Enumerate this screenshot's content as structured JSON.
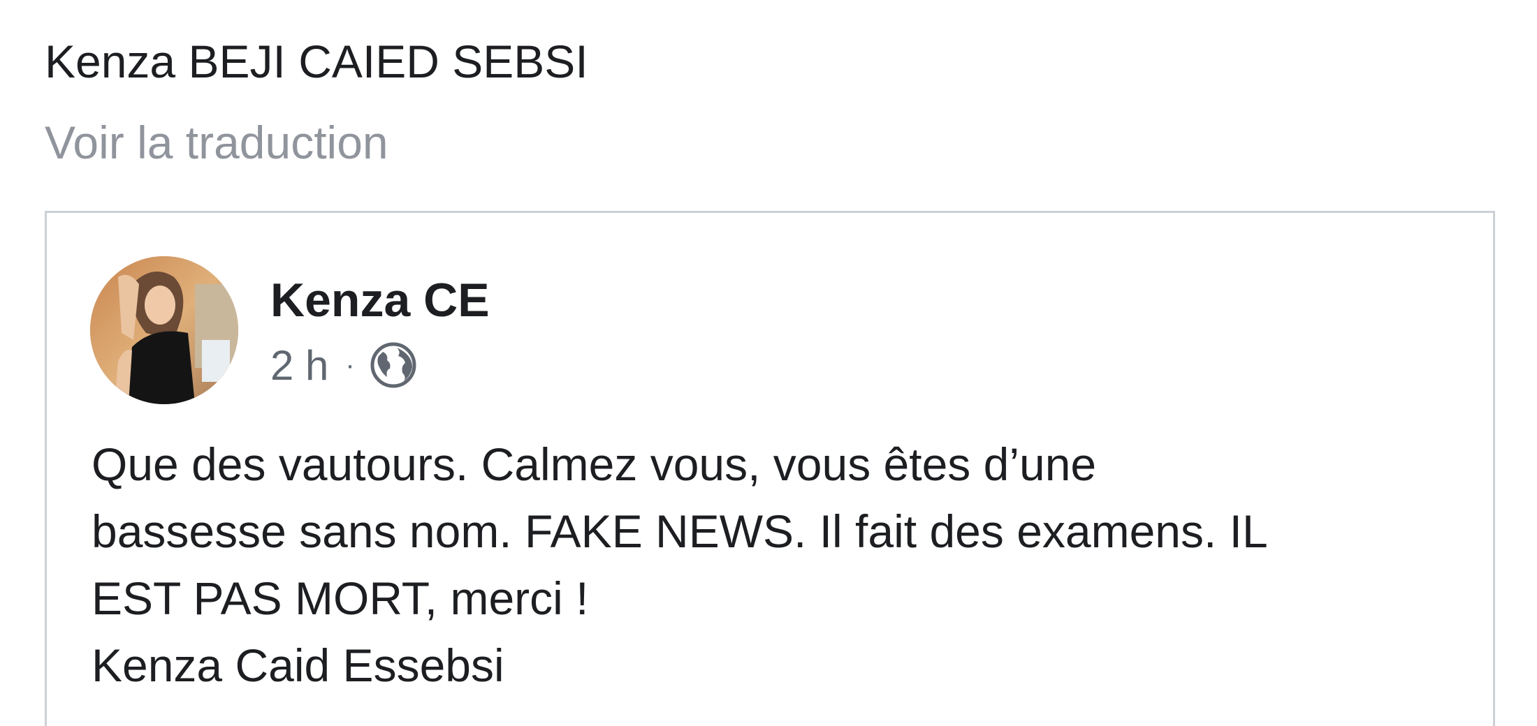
{
  "post": {
    "author": "Kenza BEJI CAIED SEBSI",
    "translate_label": "Voir la traduction"
  },
  "shared_post": {
    "author": "Kenza CE",
    "time": "2 h",
    "separator": "·",
    "audience_icon": "globe-icon",
    "body": "Que des vautours. Calmez vous, vous êtes d’une\nbassesse sans nom. FAKE NEWS. Il fait des examens. IL\nEST PAS MORT, merci !\nKenza Caid Essebsi"
  }
}
